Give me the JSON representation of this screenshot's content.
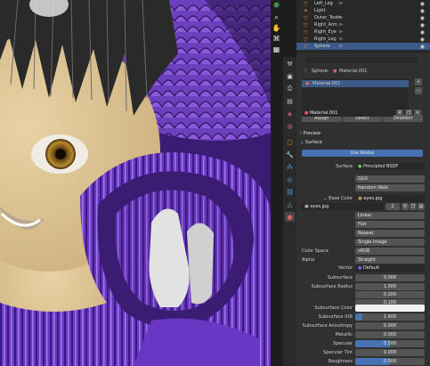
{
  "outliner": {
    "items": [
      {
        "name": "Left_Leg",
        "selected": false
      },
      {
        "name": "Light",
        "selected": false
      },
      {
        "name": "Outer_Tooth",
        "selected": false
      },
      {
        "name": "Right_Arm",
        "selected": false
      },
      {
        "name": "Right_Eye",
        "selected": false
      },
      {
        "name": "Right_Leg",
        "selected": false
      },
      {
        "name": "Sphere",
        "selected": true
      }
    ]
  },
  "properties": {
    "breadcrumb": {
      "object": "Sphere",
      "material": "Material.001"
    },
    "slot_name": "Material.001",
    "slot_buttons": [
      "Assign",
      "Select",
      "Deselect"
    ],
    "material_name": "Material.001",
    "sections": {
      "preview": "Preview",
      "surface": "Surface"
    },
    "use_nodes": "Use Nodes",
    "surface_label": "Surface",
    "surface_value": "Principled BSDF",
    "distribution": "GGX",
    "subsurface_method": "Random Walk",
    "base_color_label": "Base Color",
    "base_color_value": "eyes.jpg",
    "image_name": "eyes.jpg",
    "image_users": "2",
    "interpolation": "Linear",
    "projection": "Flat",
    "extension": "Repeat",
    "source": "Single Image",
    "color_space_label": "Color Space",
    "color_space_value": "sRGB",
    "alpha_label": "Alpha",
    "alpha_value": "Straight",
    "vector_label": "Vector",
    "vector_value": "Default",
    "fields": [
      {
        "label": "Subsurface",
        "value": "0.000"
      },
      {
        "label": "Subsurface Radius",
        "value": "1.000"
      },
      {
        "label": "",
        "value": "0.200"
      },
      {
        "label": "",
        "value": "0.100"
      },
      {
        "label": "Subsurface Color",
        "value": ""
      },
      {
        "label": "Subsurface IOR",
        "value": "1.400"
      },
      {
        "label": "Subsurface Anisotropy",
        "value": "0.000"
      },
      {
        "label": "Metallic",
        "value": "0.000"
      },
      {
        "label": "Specular",
        "value": "0.500"
      },
      {
        "label": "Specular Tint",
        "value": "0.000"
      },
      {
        "label": "Roughness",
        "value": "0.500"
      }
    ]
  },
  "colors": {
    "accent": "#4772b3",
    "selection": "#3b5a89",
    "panel": "#303030",
    "field": "#545454",
    "purple": "#7a45c8"
  }
}
